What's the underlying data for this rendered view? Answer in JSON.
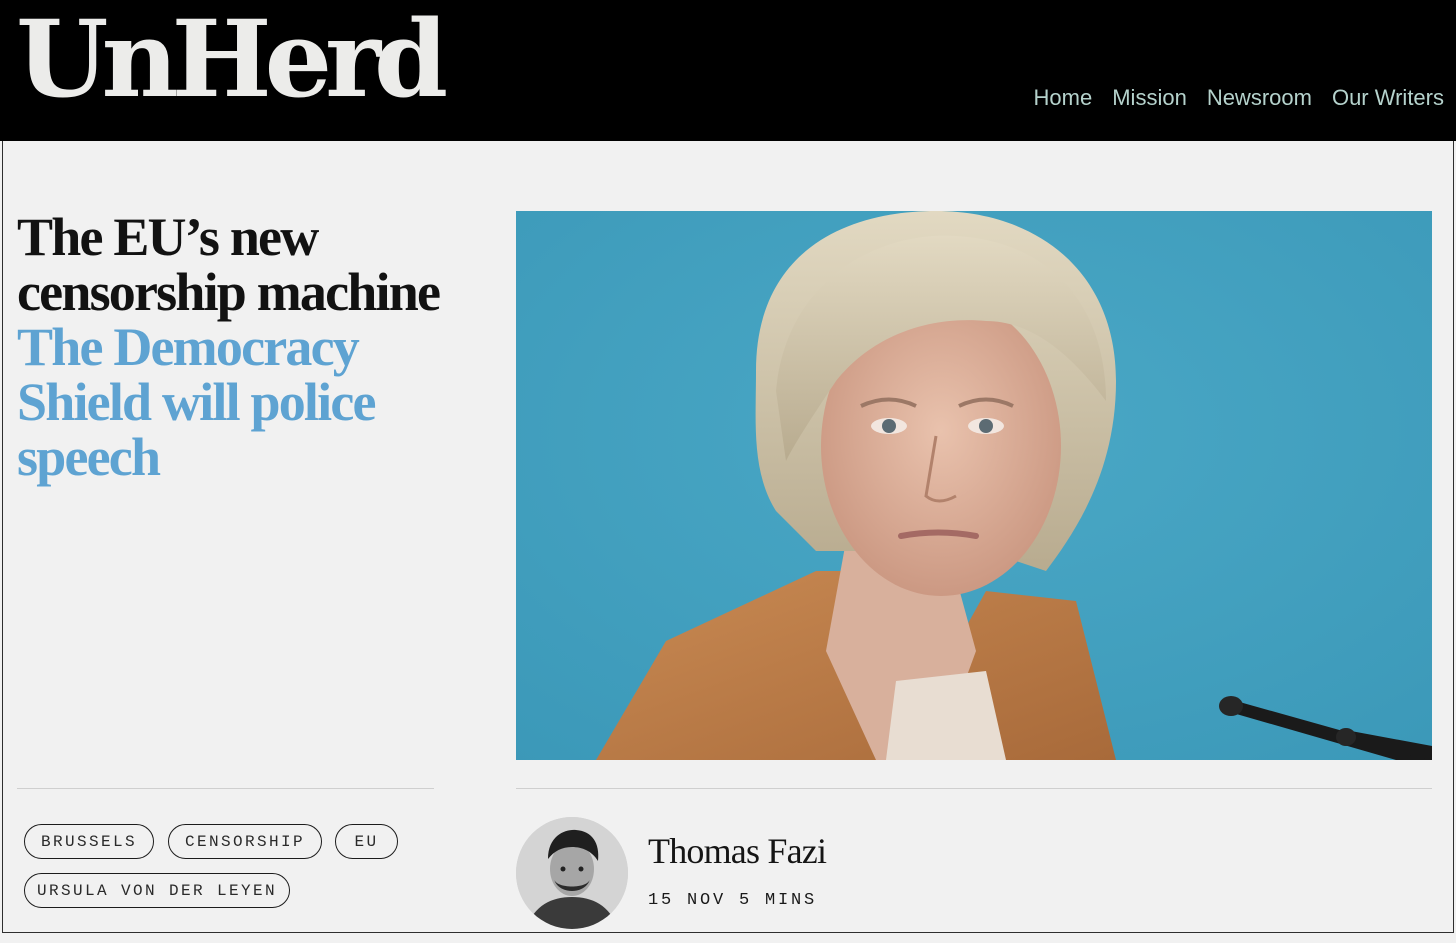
{
  "site": {
    "logo": "UnHerd"
  },
  "nav": [
    {
      "label": "Home"
    },
    {
      "label": "Mission"
    },
    {
      "label": "Newsroom"
    },
    {
      "label": "Our Writers"
    }
  ],
  "article": {
    "title": "The EU’s new censorship machine",
    "standfirst": "The Democracy Shield will police speech",
    "tags": [
      "BRUSSELS",
      "CENSORSHIP",
      "EU",
      "URSULA VON DER LEYEN"
    ],
    "author": "Thomas Fazi",
    "date": "15 NOV",
    "read_time": "5 MINS"
  },
  "colors": {
    "header_bg": "#000000",
    "page_bg": "#f1f1f1",
    "nav_link": "#b5d2cc",
    "standfirst": "#5ea3d2",
    "hero_bg": "#3f9fbf"
  }
}
